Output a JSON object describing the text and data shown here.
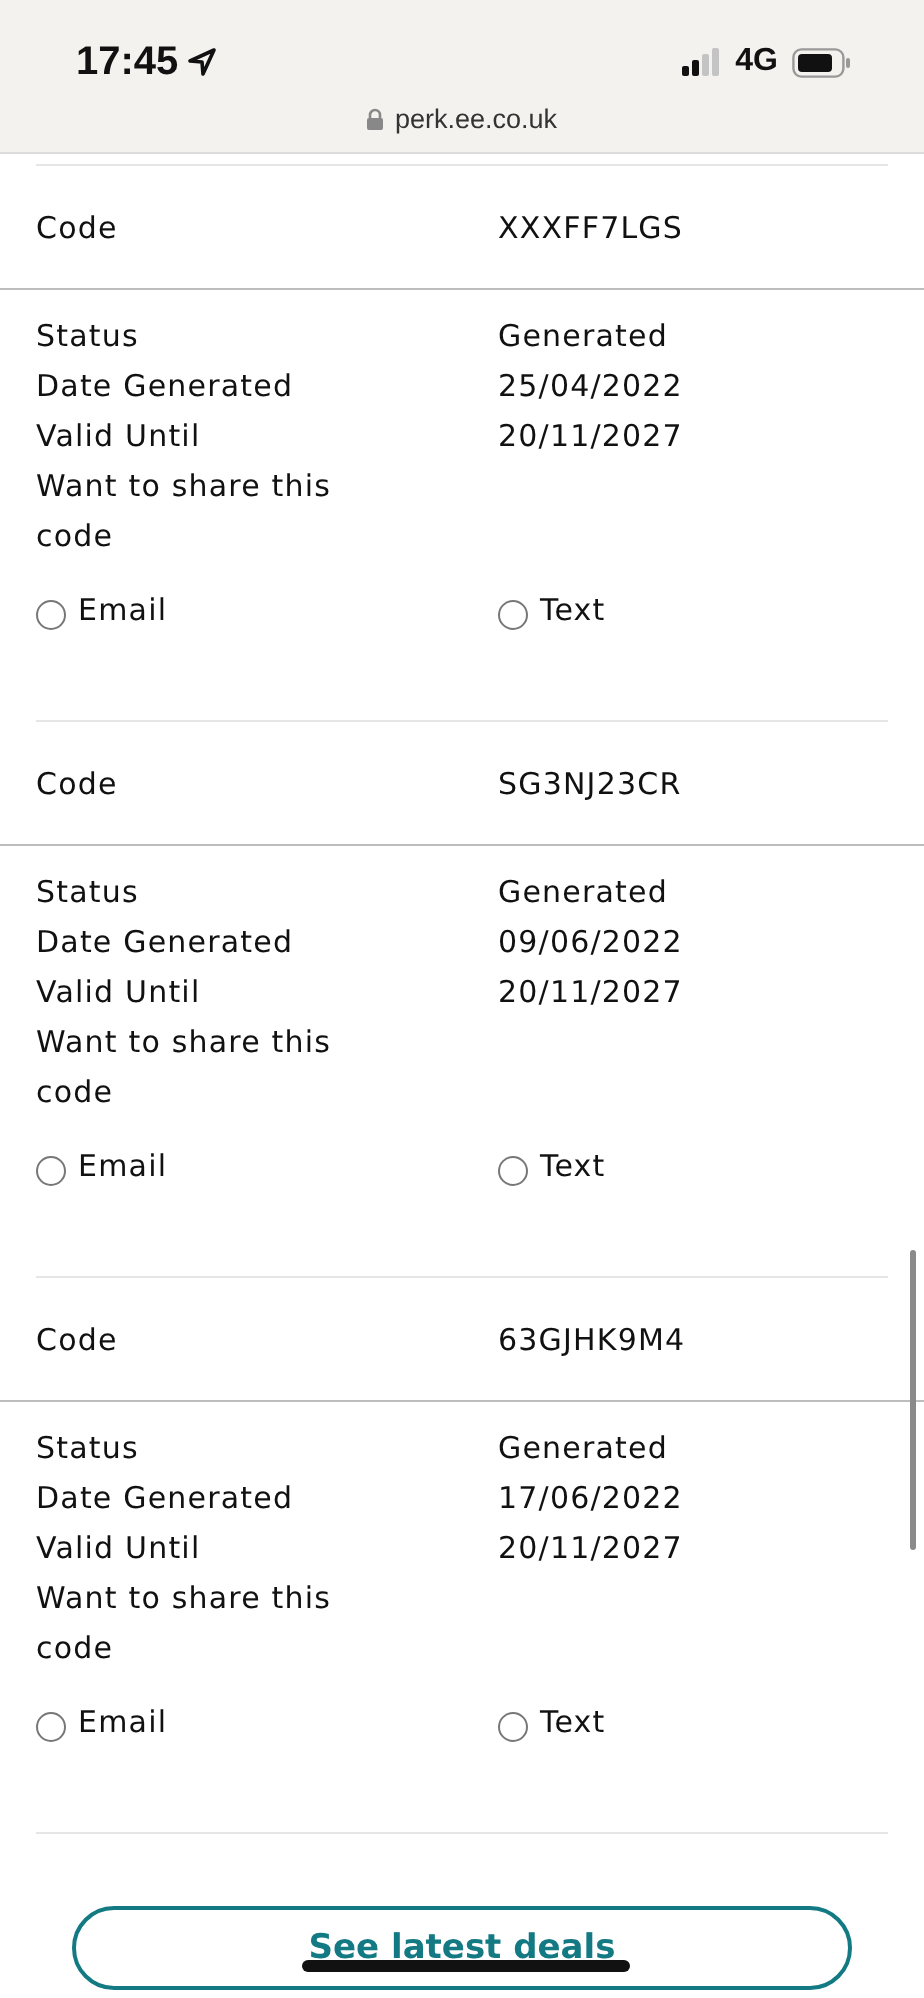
{
  "status_bar": {
    "time": "17:45",
    "network": "4G"
  },
  "address_bar": {
    "url": "perk.ee.co.uk"
  },
  "codes": [
    {
      "code_label": "Code",
      "code": "XXXFF7LGS",
      "rows": [
        {
          "label": "Status",
          "value": "Generated"
        },
        {
          "label": "Date Generated",
          "value": "25/04/2022"
        },
        {
          "label": "Valid Until",
          "value": "20/11/2027"
        }
      ],
      "share_prompt": "Want to share this code",
      "options": [
        {
          "label": "Email",
          "selected": false
        },
        {
          "label": "Text",
          "selected": false
        }
      ]
    },
    {
      "code_label": "Code",
      "code": "SG3NJ23CR",
      "rows": [
        {
          "label": "Status",
          "value": "Generated"
        },
        {
          "label": "Date Generated",
          "value": "09/06/2022"
        },
        {
          "label": "Valid Until",
          "value": "20/11/2027"
        }
      ],
      "share_prompt": "Want to share this code",
      "options": [
        {
          "label": "Email",
          "selected": false
        },
        {
          "label": "Text",
          "selected": false
        }
      ]
    },
    {
      "code_label": "Code",
      "code": "63GJHK9M4",
      "rows": [
        {
          "label": "Status",
          "value": "Generated"
        },
        {
          "label": "Date Generated",
          "value": "17/06/2022"
        },
        {
          "label": "Valid Until",
          "value": "20/11/2027"
        }
      ],
      "share_prompt": "Want to share this code",
      "options": [
        {
          "label": "Email",
          "selected": false
        },
        {
          "label": "Text",
          "selected": false
        }
      ]
    }
  ],
  "button": {
    "label": "See latest deals"
  }
}
